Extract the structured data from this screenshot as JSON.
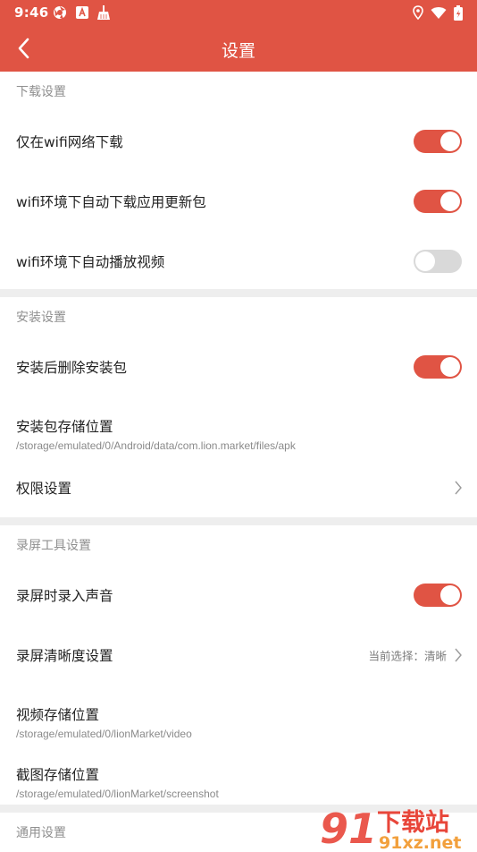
{
  "status_bar": {
    "time": "9:46",
    "left_icons": [
      "chrome-icon",
      "app-a-icon",
      "broom-icon"
    ],
    "right_icons": [
      "location-icon",
      "wifi-icon",
      "battery-icon"
    ]
  },
  "app_bar": {
    "title": "设置",
    "background_color": "#e05444"
  },
  "sections": [
    {
      "header": "下载设置",
      "rows": [
        {
          "label": "仅在wifi网络下载",
          "control": "toggle",
          "on": true
        },
        {
          "label": "wifi环境下自动下载应用更新包",
          "control": "toggle",
          "on": true
        },
        {
          "label": "wifi环境下自动播放视频",
          "control": "toggle",
          "on": false
        }
      ]
    },
    {
      "header": "安装设置",
      "rows": [
        {
          "label": "安装后删除安装包",
          "control": "toggle",
          "on": true
        },
        {
          "label": "安装包存储位置",
          "sub": "/storage/emulated/0/Android/data/com.lion.market/files/apk"
        },
        {
          "label": "权限设置",
          "control": "chevron"
        }
      ]
    },
    {
      "header": "录屏工具设置",
      "rows": [
        {
          "label": "录屏时录入声音",
          "control": "toggle",
          "on": true
        },
        {
          "label": "录屏清晰度设置",
          "control": "chevron",
          "value": "当前选择：清晰"
        },
        {
          "label": "视频存储位置",
          "sub": "/storage/emulated/0/lionMarket/video"
        },
        {
          "label": "截图存储位置",
          "sub": "/storage/emulated/0/lionMarket/screenshot"
        }
      ]
    },
    {
      "header": "通用设置",
      "rows": []
    }
  ],
  "watermark": {
    "text_main": "下载站",
    "text_url": "91xz.net",
    "colors": {
      "red": "#e8463a",
      "orange": "#f2a03d"
    }
  }
}
